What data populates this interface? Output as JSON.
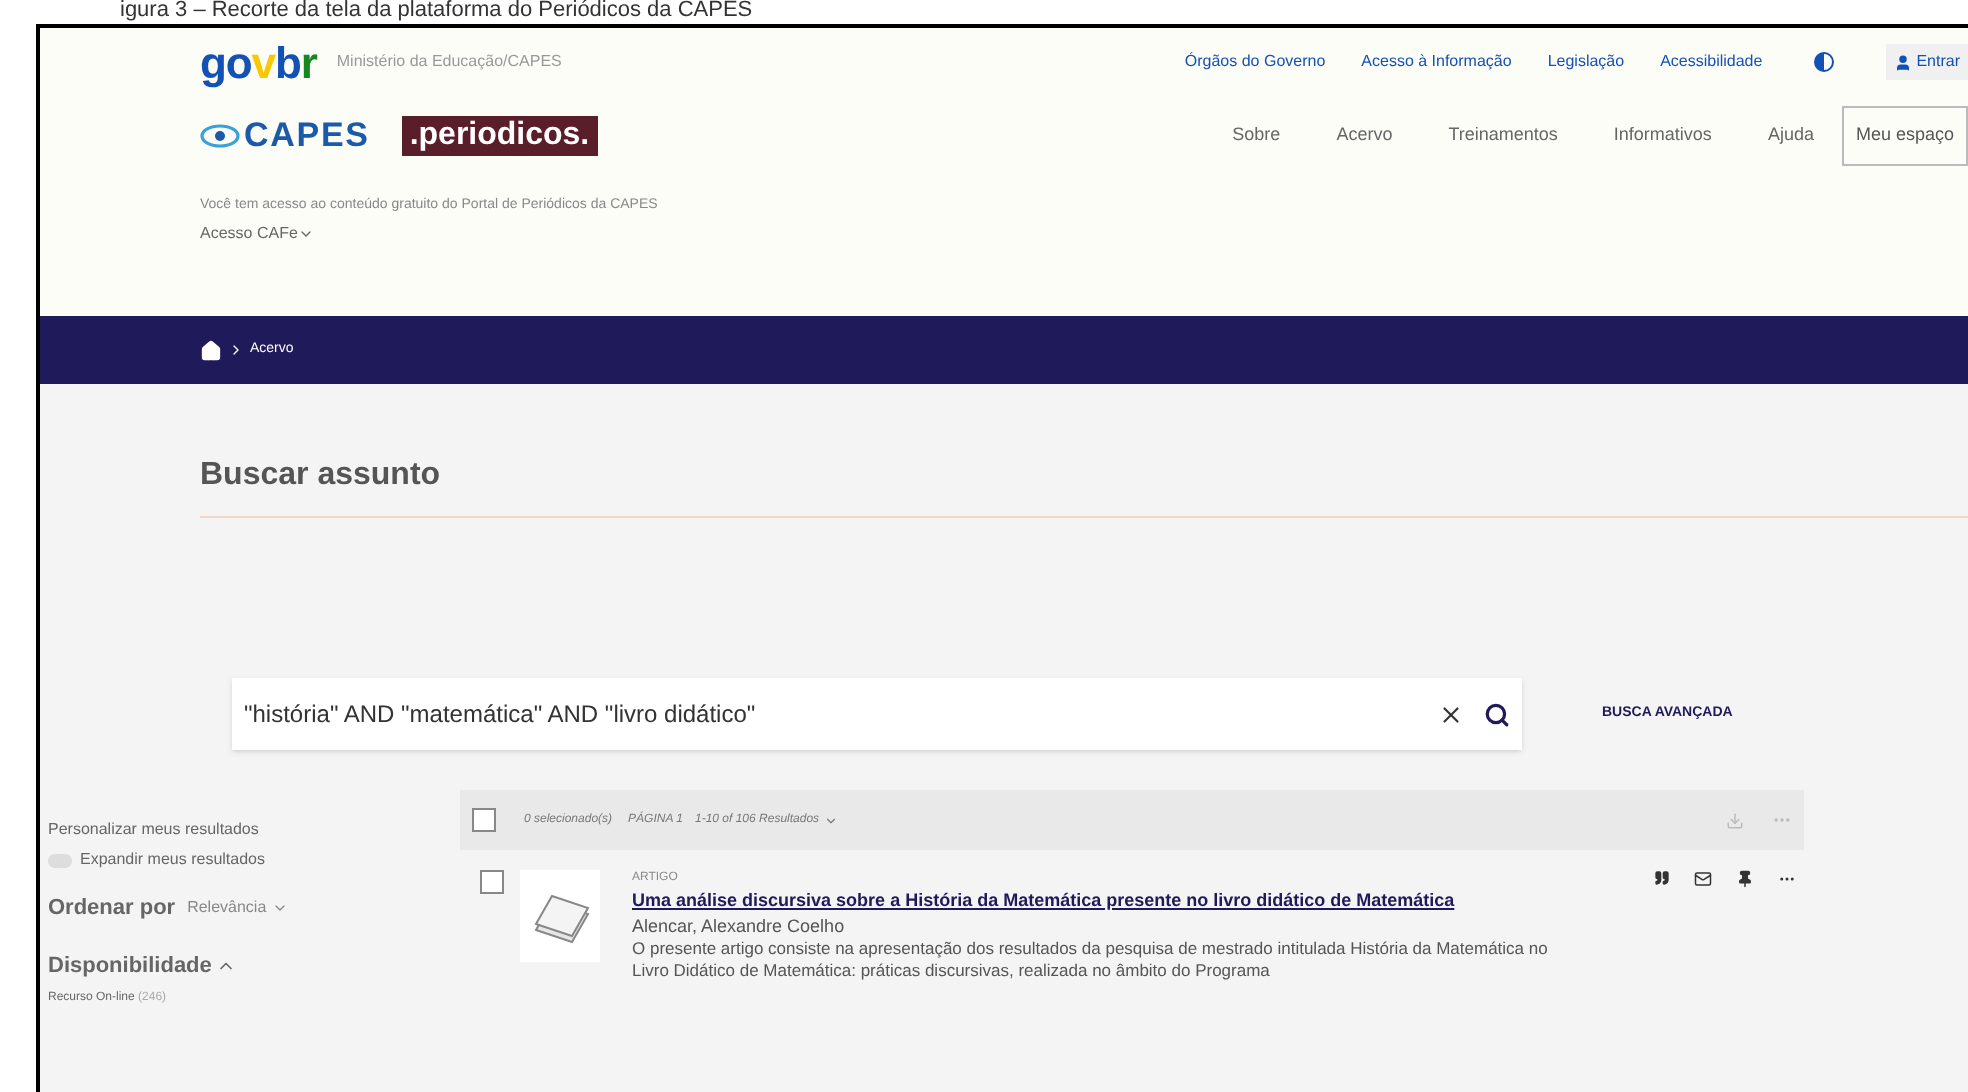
{
  "caption": "igura 3 – Recorte da tela da plataforma do Periódicos da CAPES",
  "header": {
    "govbr_logo": "govbr",
    "ministry": "Ministério da Educação/CAPES",
    "top_links": [
      "Órgãos do Governo",
      "Acesso à Informação",
      "Legislação",
      "Acessibilidade"
    ],
    "login": "Entrar",
    "capes_logo": "CAPES",
    "periodicos_logo": ".periodicos.",
    "nav": [
      "Sobre",
      "Acervo",
      "Treinamentos",
      "Informativos",
      "Ajuda"
    ],
    "my_space": "Meu espaço",
    "access_note": "Você tem acesso ao conteúdo gratuito do Portal de Periódicos da CAPES",
    "cafe": "Acesso CAFe"
  },
  "breadcrumb": [
    "Acervo"
  ],
  "page_title": "Buscar assunto",
  "search": {
    "value": "\"história\" AND \"matemática\" AND \"livro didático\"",
    "advanced": "BUSCA AVANÇADA"
  },
  "sidebar": {
    "personalize": "Personalizar meus resultados",
    "expand": {
      "label": "Expandir meus resultados",
      "on": false
    },
    "sort_label": "Ordenar por",
    "sort_value": "Relevância",
    "availability": "Disponibilidade",
    "expanded": true,
    "filters": [
      {
        "label": "Recurso On-line",
        "count": "(246)"
      }
    ]
  },
  "toolbar": {
    "checked": false,
    "selected": "0 selecionado(s)",
    "page": "PÁGINA 1",
    "range": "1-10 of 106 Resultados"
  },
  "results": [
    {
      "checked": false,
      "type": "ARTIGO",
      "title": "Uma análise discursiva sobre a História da Matemática presente no livro didático de Matemática",
      "author": "Alencar, Alexandre Coelho",
      "abstract": "O presente artigo consiste na apresentação dos resultados da pesquisa de mestrado intitulada História da Matemática no Livro Didático de Matemática: práticas discursivas, realizada no âmbito do Programa"
    }
  ]
}
